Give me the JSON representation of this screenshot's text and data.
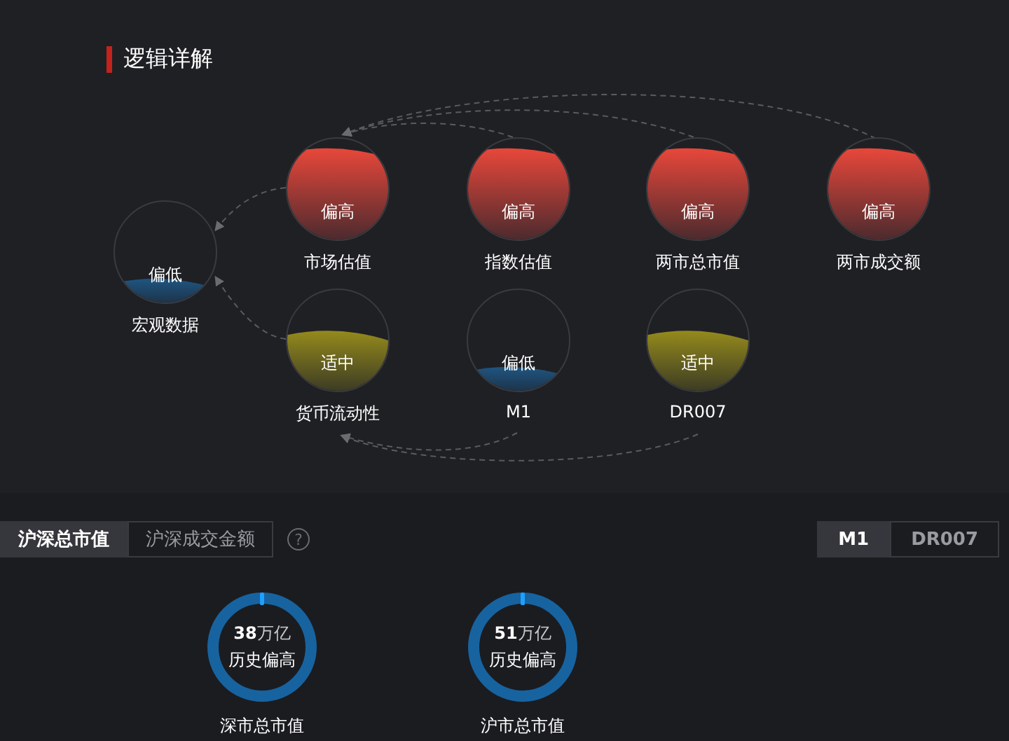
{
  "section_title": "逻辑详解",
  "nodes": [
    {
      "name": "宏观数据",
      "status": "偏低",
      "kind": "low"
    },
    {
      "name": "市场估值",
      "status": "偏高",
      "kind": "high"
    },
    {
      "name": "指数估值",
      "status": "偏高",
      "kind": "high"
    },
    {
      "name": "两市总市值",
      "status": "偏高",
      "kind": "high"
    },
    {
      "name": "两市成交额",
      "status": "偏高",
      "kind": "high"
    },
    {
      "name": "货币流动性",
      "status": "适中",
      "kind": "mid"
    },
    {
      "name": "M1",
      "status": "偏低",
      "kind": "low"
    },
    {
      "name": "DR007",
      "status": "适中",
      "kind": "mid"
    }
  ],
  "left_tabs": [
    {
      "label": "沪深总市值",
      "selected": true
    },
    {
      "label": "沪深成交金额",
      "selected": false
    }
  ],
  "help_icon": "?",
  "right_tabs": [
    {
      "label": "M1",
      "selected": true
    },
    {
      "label": "DR007",
      "selected": false
    }
  ],
  "gauges": [
    {
      "value": "**38**万亿",
      "status": "历史偏高",
      "name": "深市总市值"
    },
    {
      "value": "**51**万亿",
      "status": "历史偏高",
      "name": "沪市总市值"
    }
  ]
}
